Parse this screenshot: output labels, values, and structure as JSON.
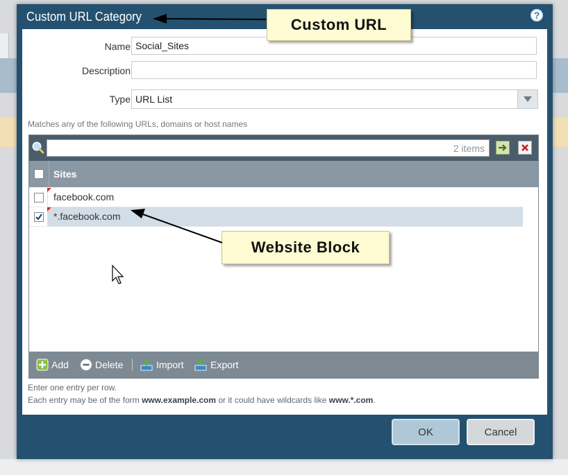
{
  "dialog": {
    "title": "Custom URL Category",
    "help_icon": "help-icon",
    "name_label": "Name",
    "name_value": "Social_Sites",
    "description_label": "Description",
    "description_value": "",
    "type_label": "Type",
    "type_value": "URL List",
    "match_hint": "Matches any of the following URLs, domains or host names",
    "items_count": "2 items",
    "sites_header": "Sites",
    "sites": [
      {
        "url": "facebook.com",
        "checked": false
      },
      {
        "url": "*.facebook.com",
        "checked": true
      }
    ],
    "toolbar": {
      "add": "Add",
      "delete": "Delete",
      "import": "Import",
      "export": "Export"
    },
    "footer_hint_1": "Enter one entry per row.",
    "footer_hint_2_prefix": "Each entry may be of the form ",
    "footer_hint_2_example1": "www.example.com",
    "footer_hint_2_middle": " or it could have wildcards like ",
    "footer_hint_2_example2": "www.*.com",
    "footer_hint_2_suffix": ".",
    "ok_label": "OK",
    "cancel_label": "Cancel"
  },
  "annotations": {
    "custom_url": "Custom URL",
    "website_block": "Website Block"
  },
  "colors": {
    "dialog_frame": "#24516f",
    "grid_header": "#8a98a3",
    "selected_row": "#d2dde6",
    "callout": "#fffbd2"
  }
}
